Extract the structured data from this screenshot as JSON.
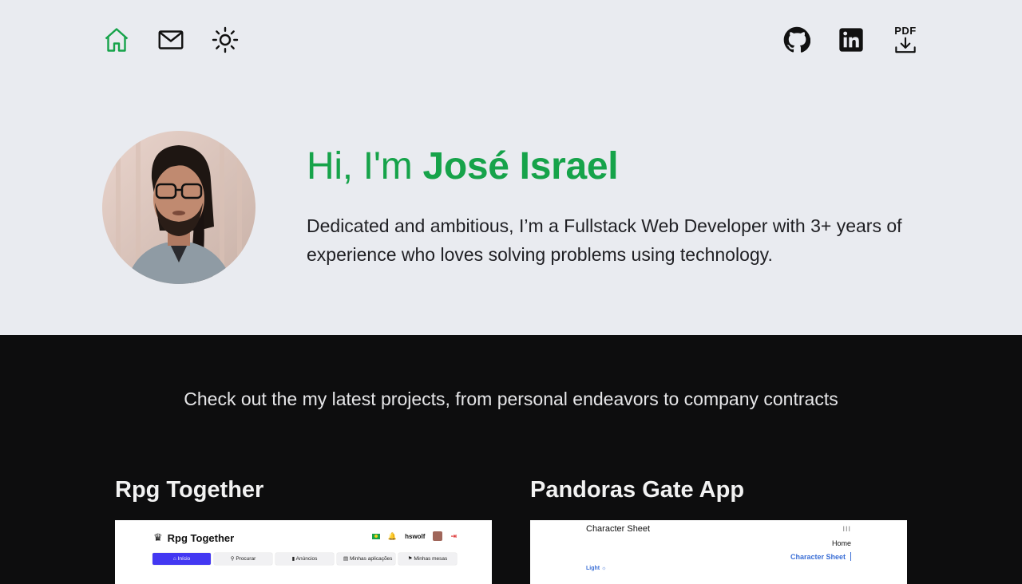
{
  "nav": {
    "left_icons": [
      "home-icon",
      "mail-icon",
      "sun-icon"
    ],
    "right_icons": [
      "github-icon",
      "linkedin-icon",
      "pdf-download-icon"
    ],
    "pdf_label": "PDF",
    "active_color": "#16a34a"
  },
  "hero": {
    "greeting_prefix": "Hi, I'm",
    "name": "José Israel",
    "bio": "Dedicated and ambitious, I’m a Fullstack Web Developer with 3+ years of experience who loves solving problems using technology."
  },
  "projects": {
    "tagline": "Check out the my latest projects, from personal endeavors to company contracts",
    "items": [
      {
        "title": "Rpg Together",
        "preview": {
          "logo": "Rpg Together",
          "user": "hswolf",
          "tabs": [
            "Início",
            "Procurar",
            "Anúncios",
            "Minhas aplicações",
            "Minhas mesas"
          ]
        }
      },
      {
        "title": "Pandoras Gate App",
        "preview": {
          "title": "Character Sheet",
          "menu": "III",
          "nav_home": "Home",
          "nav_active": "Character Sheet",
          "theme": "Light"
        }
      }
    ]
  },
  "colors": {
    "accent": "#16a34a",
    "hero_bg": "#e9ebf0",
    "dark_bg": "#0d0d0e",
    "preview_accent": "#4338f2"
  }
}
